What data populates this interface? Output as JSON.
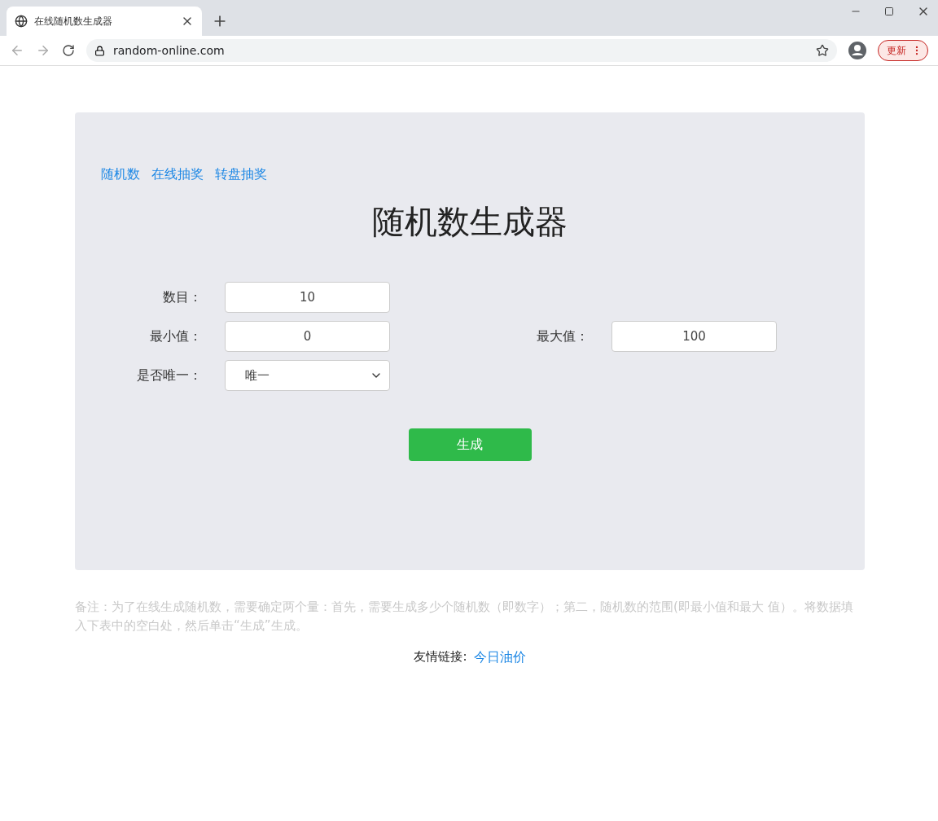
{
  "browser": {
    "tab_title": "在线随机数生成器",
    "url": "random-online.com",
    "update_button": "更新"
  },
  "nav_links": [
    "随机数",
    "在线抽奖",
    "转盘抽奖"
  ],
  "title": "随机数生成器",
  "form": {
    "count": {
      "label": "数目：",
      "value": "10"
    },
    "min": {
      "label": "最小值：",
      "value": "0"
    },
    "max": {
      "label": "最大值：",
      "value": "100"
    },
    "unique": {
      "label": "是否唯一：",
      "value": "唯一"
    }
  },
  "generate_button": "生成",
  "note": "备注：为了在线生成随机数，需要确定两个量：首先，需要生成多少个随机数（即数字）；第二，随机数的范围(即最小值和最大 值）。将数据填入下表中的空白处，然后单击“生成”生成。",
  "footer": {
    "label": "友情链接:",
    "link": "今日油价"
  }
}
